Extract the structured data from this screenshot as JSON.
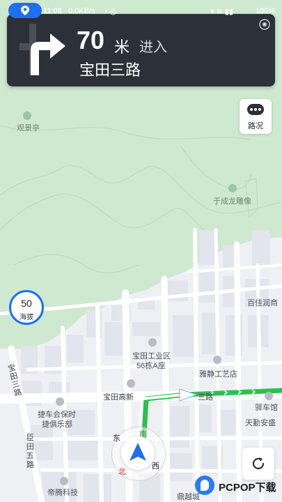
{
  "status_bar": {
    "time": "11:08",
    "network_speed": "0.0KB/s",
    "battery": "100%"
  },
  "navigation": {
    "distance": "70",
    "unit": "米",
    "action": "进入",
    "road": "宝田三路",
    "turn_icon": "turn-right-arrow-icon"
  },
  "traffic_button": {
    "label": "路况",
    "icon": "traffic-dots-icon"
  },
  "altitude": {
    "value": "50",
    "label": "海拔"
  },
  "map_labels": {
    "viewing_pavilion": "观景亭",
    "statue": "于成龙雕像",
    "baotian_park": "宝田工业区",
    "building_56a": "56栋A座",
    "yajing_arts": "雅静工艺店",
    "baotian_high_new": "宝田高新",
    "road_east": "三路",
    "baitian_runshang": "百佳润商",
    "jiechehui": "捷车会保时",
    "jiechehui2": "捷俱乐部",
    "yizhan": "驿车馆",
    "tianqin": "天勤安盛",
    "baotian_wu_road": "臣田五路",
    "baotian_side_road": "宝田三路",
    "diteng_tech": "帝腾科技",
    "dingfeng": "鼎越城"
  },
  "compass": {
    "east": "东",
    "south": "南",
    "north": "北",
    "west": "西"
  },
  "watermark": {
    "text": "PCPOP下载"
  },
  "colors": {
    "nav_card": "#2c3038",
    "route": "#2fbf4f",
    "accent": "#1e6ff2",
    "park_green": "#cfe9d1"
  }
}
